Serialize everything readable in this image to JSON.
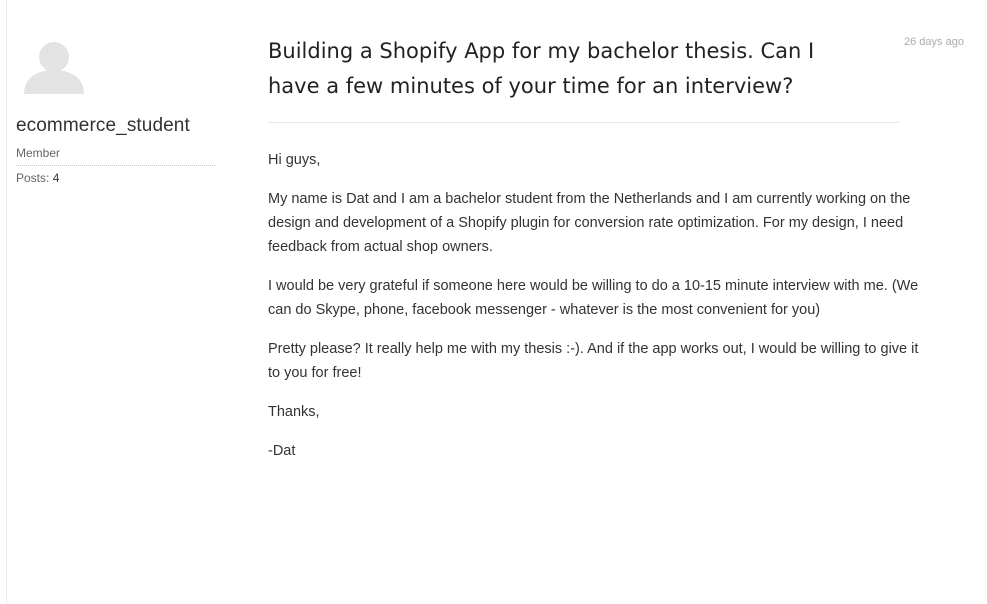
{
  "author": {
    "username": "ecommerce_student",
    "role": "Member",
    "posts_label": "Posts:",
    "posts_count": "4",
    "avatar_icon": "default-user-avatar-icon"
  },
  "post": {
    "title": "Building a Shopify App for my bachelor thesis. Can I have a few minutes of your time for an interview?",
    "timestamp": "26 days ago",
    "paragraphs": [
      "Hi guys,",
      "My name is Dat and I am a bachelor student from the Netherlands and I am currently working on the design and development of a Shopify plugin for conversion rate optimization. For my design, I need feedback from actual shop owners.",
      "I would be very grateful if someone here would be willing to do a 10-15 minute interview with me. (We can do Skype, phone, facebook messenger - whatever is the most convenient for you)",
      "Pretty please? It really help me with my thesis :-). And if the app works out, I would be willing to give it to you for free!",
      "Thanks,",
      "-Dat"
    ]
  },
  "colors": {
    "text": "#333333",
    "muted": "#666666",
    "timestamp": "#aaaaaa",
    "avatar": "#e3e3e3"
  }
}
